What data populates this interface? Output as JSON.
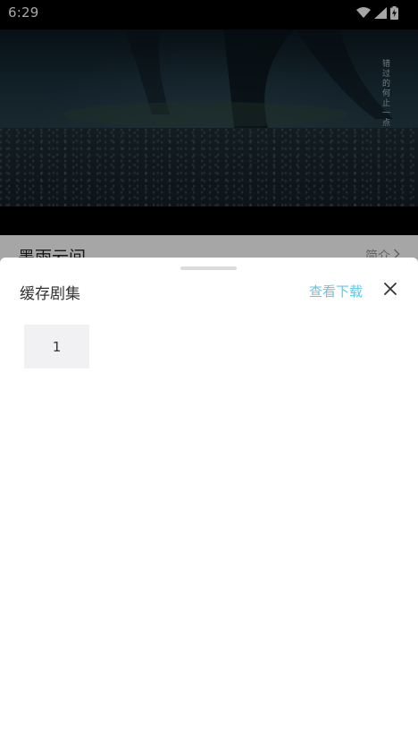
{
  "status_bar": {
    "time": "6:29",
    "icons": [
      "wifi-icon",
      "cellular-signal-icon",
      "battery-charging-icon"
    ]
  },
  "video": {
    "overlay_text": "错过的何止一点"
  },
  "show": {
    "title": "墨雨云间",
    "intro_label": "简介"
  },
  "sheet": {
    "title": "缓存剧集",
    "view_downloads_label": "查看下载",
    "close_icon": "close-icon",
    "episodes": [
      "1"
    ]
  },
  "colors": {
    "accent": "#5cc8f0",
    "episode_bg": "#f1f1f3"
  }
}
